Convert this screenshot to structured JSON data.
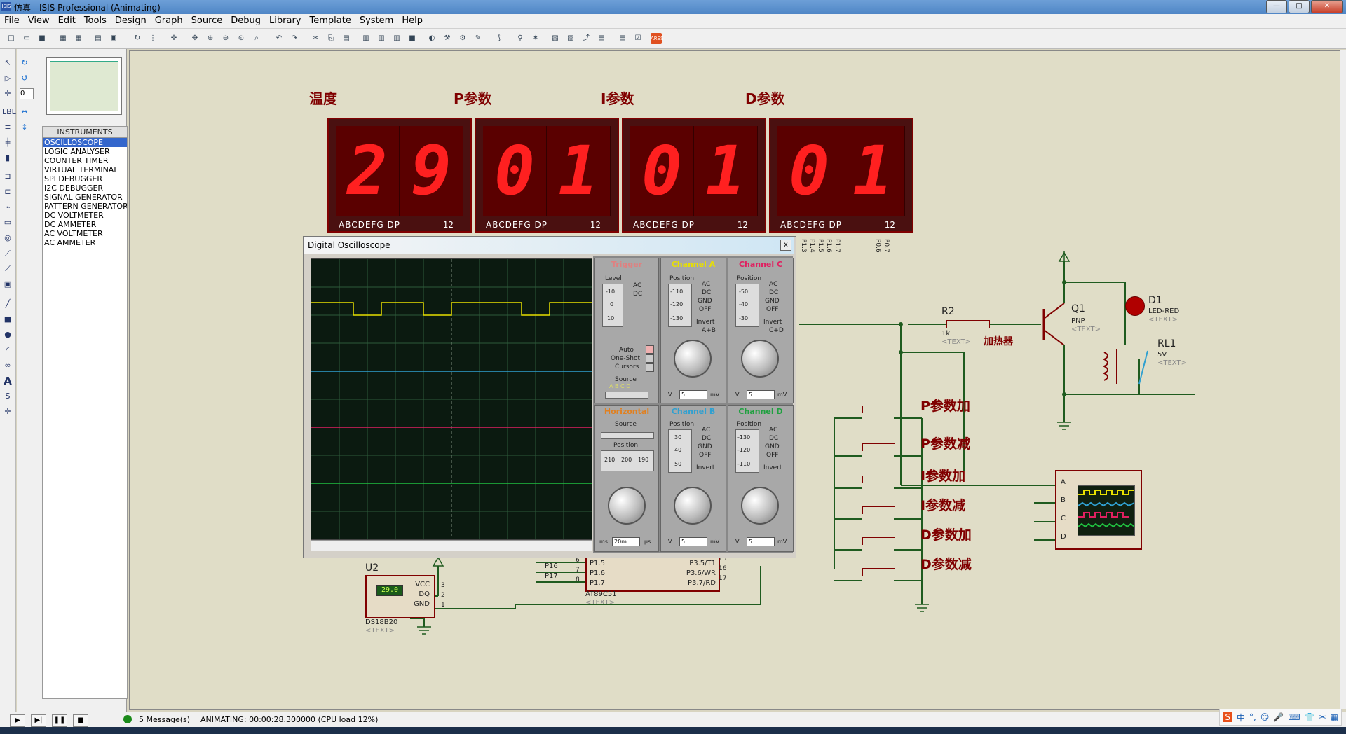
{
  "window": {
    "title": "仿真 - ISIS Professional (Animating)",
    "app_icon": "ISIS"
  },
  "window_buttons": {
    "minimize": "—",
    "maximize": "□",
    "close": "✕"
  },
  "menu": [
    "File",
    "View",
    "Edit",
    "Tools",
    "Design",
    "Graph",
    "Source",
    "Debug",
    "Library",
    "Template",
    "System",
    "Help"
  ],
  "rotation": {
    "angle": "0"
  },
  "instruments": {
    "header": "INSTRUMENTS",
    "items": [
      "OSCILLOSCOPE",
      "LOGIC ANALYSER",
      "COUNTER TIMER",
      "VIRTUAL TERMINAL",
      "SPI DEBUGGER",
      "I2C DEBUGGER",
      "SIGNAL GENERATOR",
      "PATTERN GENERATOR",
      "DC VOLTMETER",
      "DC AMMETER",
      "AC VOLTMETER",
      "AC AMMETER"
    ],
    "selected_index": 0
  },
  "displays": [
    {
      "label": "温度",
      "digits": [
        "2",
        "9"
      ]
    },
    {
      "label": "P参数",
      "digits": [
        "0",
        "1"
      ]
    },
    {
      "label": "I参数",
      "digits": [
        "0",
        "1"
      ]
    },
    {
      "label": "D参数",
      "digits": [
        "0",
        "1"
      ]
    }
  ],
  "display_pins": {
    "segments": "ABCDEFG",
    "dp": "DP",
    "digits": "12"
  },
  "pin_labels_right": [
    "P1.3",
    "P1.4",
    "P1.5",
    "P1.6",
    "P1.7"
  ],
  "pin_labels_right2": [
    "P0.6",
    "P0.7"
  ],
  "oscilloscope": {
    "title": "Digital Oscilloscope",
    "close": "x",
    "trigger": {
      "title": "Trigger",
      "level": "Level",
      "ac": "AC",
      "dc": "DC",
      "ticks": [
        "-10",
        "0",
        "10"
      ],
      "auto": "Auto",
      "oneshot": "One-Shot",
      "cursors": "Cursors",
      "source": "Source",
      "src_letters": "A B C D"
    },
    "channel_a": {
      "title": "Channel A",
      "position": "Position",
      "ticks": [
        "-110",
        "-120",
        "-130"
      ],
      "modes": [
        "AC",
        "DC",
        "GND",
        "OFF"
      ],
      "invert": "Invert",
      "aplusb": "A+B",
      "unit_v": "V",
      "unit_mv": "mV",
      "value": "5"
    },
    "channel_b": {
      "title": "Channel B",
      "position": "Position",
      "ticks": [
        "30",
        "40",
        "50"
      ],
      "modes": [
        "AC",
        "DC",
        "GND",
        "OFF"
      ],
      "invert": "Invert",
      "unit_v": "V",
      "unit_mv": "mV",
      "value": "5"
    },
    "channel_c": {
      "title": "Channel C",
      "position": "Position",
      "ticks": [
        "-50",
        "-40",
        "-30"
      ],
      "modes": [
        "AC",
        "DC",
        "GND",
        "OFF"
      ],
      "invert": "Invert",
      "cd": "C+D",
      "unit_v": "V",
      "unit_mv": "mV",
      "value": "5"
    },
    "channel_d": {
      "title": "Channel D",
      "position": "Position",
      "ticks": [
        "-130",
        "-120",
        "-110"
      ],
      "modes": [
        "AC",
        "DC",
        "GND",
        "OFF"
      ],
      "invert": "Invert",
      "unit_v": "V",
      "unit_mv": "mV",
      "value": "5"
    },
    "horizontal": {
      "title": "Horizontal",
      "source": "Source",
      "position": "Position",
      "ticks": [
        "210",
        "200",
        "190"
      ],
      "unit_ms": "ms",
      "unit_us": "µs",
      "value": "20m"
    },
    "colors": {
      "a": "#e8e000",
      "b": "#30a0d0",
      "c": "#e02060",
      "d": "#20c040",
      "grid": "#2e5a3a"
    }
  },
  "components": {
    "r2": {
      "name": "R2",
      "value": "1k",
      "text": "<TEXT>"
    },
    "heater": "加热器",
    "q1": {
      "name": "Q1",
      "type": "PNP",
      "text": "<TEXT>"
    },
    "d1": {
      "name": "D1",
      "type": "LED-RED",
      "text": "<TEXT>"
    },
    "rl1": {
      "name": "RL1",
      "value": "5V",
      "text": "<TEXT>"
    },
    "u2": {
      "name": "U2",
      "reading": "29.0",
      "pins": [
        "VCC",
        "DQ",
        "GND"
      ],
      "pin_numbers": [
        "3",
        "2",
        "1"
      ],
      "part": "DS18B20",
      "text": "<TEXT>"
    },
    "mcu": {
      "part": "AT89C51",
      "text": "<TEXT>",
      "left_pins": [
        "P1.5",
        "P1.6",
        "P1.7"
      ],
      "left_nets": [
        "P16",
        "P17"
      ],
      "left_numbers": [
        "6",
        "7",
        "8"
      ],
      "right_pins": [
        "P3.5/T1",
        "P3.6/WR",
        "P3.7/RD"
      ],
      "right_numbers": [
        "15",
        "16",
        "17"
      ]
    },
    "scope_symbol": {
      "channels": [
        "A",
        "B",
        "C",
        "D"
      ]
    }
  },
  "buttons": [
    "P参数加",
    "P参数减",
    "I参数加",
    "I参数减",
    "D参数加",
    "D参数减"
  ],
  "status": {
    "messages": "5 Message(s)",
    "animation": "ANIMATING: 00:00:28.300000 (CPU load 12%)",
    "controls": [
      "▶",
      "▶|",
      "❚❚",
      "■"
    ]
  },
  "tray": [
    "S",
    "中",
    "°,",
    "☺",
    "🎤",
    "⌨",
    "👕",
    "✂",
    "▦"
  ]
}
